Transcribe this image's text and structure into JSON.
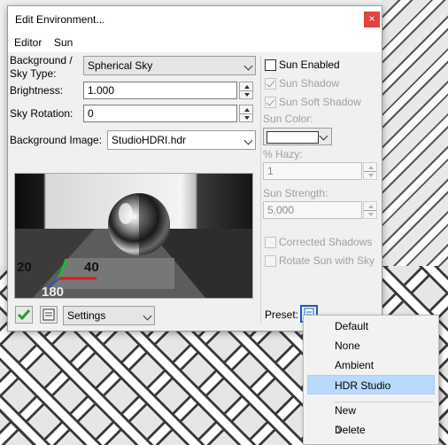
{
  "dialog": {
    "title": "Edit Environment...",
    "close_symbol": "×"
  },
  "menu": [
    "Editor",
    "Sun"
  ],
  "left": {
    "bg_sky_type_label_line1": "Background /",
    "bg_sky_type_label_line2": "Sky Type:",
    "bg_sky_type_value": "Spherical Sky",
    "brightness_label": "Brightness:",
    "brightness_value": "1.000",
    "sky_rotation_label": "Sky Rotation:",
    "sky_rotation_value": "0",
    "bg_image_label": "Background Image:",
    "bg_image_value": "StudioHDRI.hdr",
    "preview_numbers": [
      "20",
      "40",
      "180"
    ],
    "settings_value": "Settings"
  },
  "sun": {
    "sun_enabled_label": "Sun Enabled",
    "sun_enabled_checked": false,
    "sun_shadow_label": "Sun Shadow",
    "sun_shadow_checked": true,
    "sun_soft_shadow_label": "Sun Soft Shadow",
    "sun_soft_shadow_checked": true,
    "sun_color_label": "Sun Color:",
    "haze_label": "% Hazy:",
    "haze_value": "1",
    "strength_label": "Sun Strength:",
    "strength_value": "5.000",
    "corrected_shadows_label": "Corrected Shadows",
    "rotate_sun_label": "Rotate Sun with Sky",
    "preset_label": "Preset:"
  },
  "context_menu": {
    "items": [
      "Default",
      "None",
      "Ambient",
      "HDR Studio"
    ],
    "selected": "HDR Studio",
    "items2": [
      "New",
      "Delete"
    ]
  },
  "colors": {
    "close_button": "#e04343",
    "selection": "#b9d9ff",
    "preset_icon": "#1a5fb4"
  }
}
